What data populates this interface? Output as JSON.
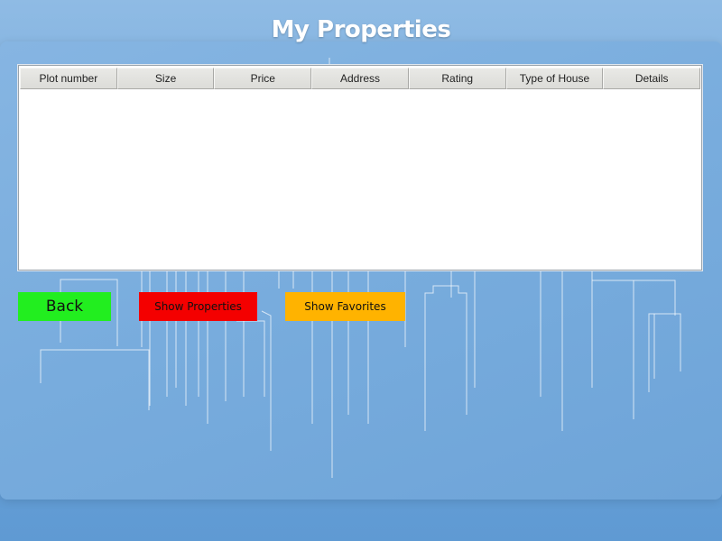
{
  "page": {
    "title": "My Properties"
  },
  "table": {
    "columns": [
      "Plot number",
      "Size",
      "Price",
      "Address",
      "Rating",
      "Type of House",
      "Details"
    ],
    "rows": []
  },
  "buttons": {
    "back": {
      "label": "Back",
      "color": "#22ee1f"
    },
    "show_properties": {
      "label": "Show Properties",
      "color": "#f40000"
    },
    "show_favorites": {
      "label": "Show Favorites",
      "color": "#ffb300"
    }
  },
  "colors": {
    "background": "#6ea4d8",
    "title_text": "#ffffff",
    "table_header": "#dcdcd8"
  }
}
